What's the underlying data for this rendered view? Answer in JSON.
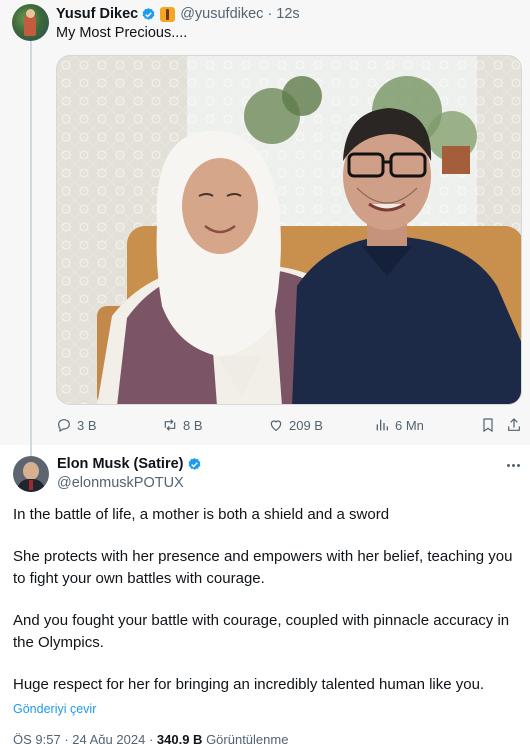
{
  "parent_tweet": {
    "author_name": "Yusuf Dikec",
    "handle": "@yusufdikec",
    "time": "· 12s",
    "text": "My Most Precious....",
    "actions": {
      "replies": "3 B",
      "reposts": "8 B",
      "likes": "209 B",
      "views": "6 Mn"
    }
  },
  "reply_tweet": {
    "author_name": "Elon Musk (Satire)",
    "handle": "@elonmuskPOTUX",
    "paragraphs": [
      "In the battle of life, a mother is both a shield and a sword",
      "She protects with her presence and empowers with her belief, teaching you to fight your own battles with courage.",
      "And you fought your battle with courage, coupled with pinnacle accuracy in the Olympics.",
      "Huge respect for her for bringing an incredibly talented human like you."
    ],
    "translate_label": "Gönderiyi çevir",
    "meta": {
      "time": "ÖS 9:57",
      "date": "24 Ağu 2024",
      "views_count": "340,9 B",
      "views_label": "Görüntülenme"
    }
  },
  "colors": {
    "accent": "#1d9bf0",
    "secondary_text": "#536471",
    "verified": "#1d9bf0"
  },
  "icons": [
    "verified-badge-icon",
    "reply-icon",
    "repost-icon",
    "like-icon",
    "views-icon",
    "bookmark-icon",
    "share-icon",
    "more-icon"
  ]
}
